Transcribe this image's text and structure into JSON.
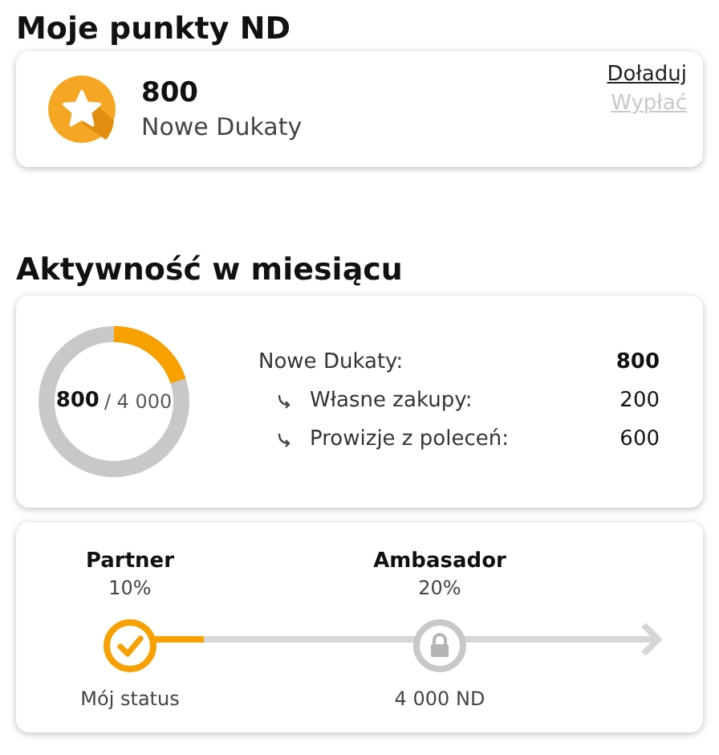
{
  "points_section": {
    "title": "Moje punkty ND",
    "amount": "800",
    "unit": "Nowe Dukaty",
    "links": [
      {
        "label": "Doładuj",
        "disabled": false
      },
      {
        "label": "Wypłać",
        "disabled": true
      }
    ]
  },
  "activity_section": {
    "title": "Aktywność w miesiącu",
    "donut": {
      "level": 0.2,
      "value": "800",
      "total": "/ 4 000"
    },
    "rows": [
      {
        "kind": "total",
        "label": "Nowe Dukaty:",
        "value": "800"
      },
      {
        "kind": "sub",
        "label": "Własne zakupy:",
        "value": "200"
      },
      {
        "kind": "sub",
        "label": "Prowizje z poleceń:",
        "value": "600"
      }
    ]
  },
  "status_section": {
    "progress": {
      "level": 0.14
    },
    "tiers": [
      {
        "name": "Partner",
        "percent": "10%",
        "achieved": true,
        "caption": "Mój status"
      },
      {
        "name": "Ambasador",
        "percent": "20%",
        "achieved": false,
        "caption": "4 000 ND"
      }
    ]
  }
}
